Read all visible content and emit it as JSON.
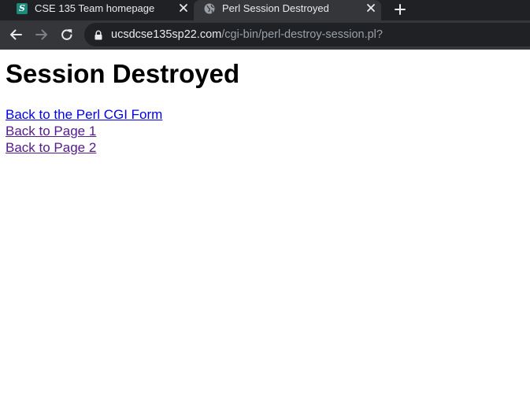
{
  "browser": {
    "tabs": [
      {
        "title": "CSE 135 Team homepage",
        "favicon": "s-logo-icon",
        "active": false
      },
      {
        "title": "Perl Session Destroyed",
        "favicon": "globe-icon",
        "active": true
      }
    ],
    "new_tab_icon": "plus-icon",
    "toolbar": {
      "back_icon": "arrow-left-icon",
      "forward_icon": "arrow-right-icon",
      "reload_icon": "reload-icon"
    },
    "address": {
      "lock_icon": "lock-icon",
      "host": "ucsdcse135sp22.com",
      "path": "/cgi-bin/perl-destroy-session.pl?"
    },
    "colors": {
      "tabstrip": "#202124",
      "toolbar": "#35363a",
      "omnibox": "#202124",
      "text_light": "#e8eaed",
      "text_dim": "#9aa0a6",
      "link": "#0000ee",
      "link_visited": "#551a8b"
    }
  },
  "page": {
    "heading": "Session Destroyed",
    "links": [
      {
        "label": "Back to the Perl CGI Form",
        "visited": false
      },
      {
        "label": "Back to Page 1",
        "visited": true
      },
      {
        "label": "Back to Page 2",
        "visited": true
      }
    ]
  }
}
